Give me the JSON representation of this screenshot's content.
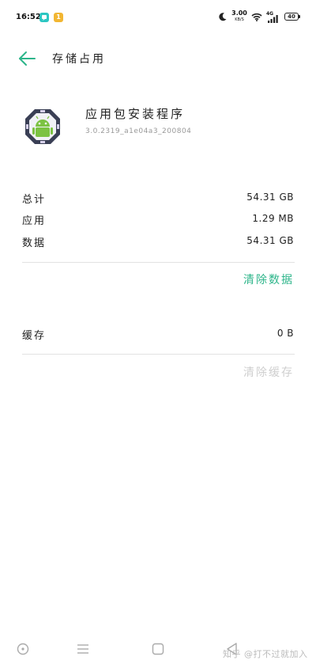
{
  "status_bar": {
    "time": "16:52",
    "notif_2_text": "1",
    "net_speed": "3.00",
    "net_unit": "KB/S",
    "signal_label": "4G",
    "battery": "40"
  },
  "header": {
    "title": "存储占用"
  },
  "app": {
    "name": "应用包安装程序",
    "version": "3.0.2319_a1e04a3_200804"
  },
  "storage": {
    "total_label": "总计",
    "total_value": "54.31 GB",
    "app_label": "应用",
    "app_value": "1.29 MB",
    "data_label": "数据",
    "data_value": "54.31 GB",
    "clear_data_label": "清除数据"
  },
  "cache": {
    "label": "缓存",
    "value": "0 B",
    "clear_cache_label": "清除缓存"
  },
  "watermark": "知乎 @打不过就加入",
  "colors": {
    "accent": "#2db58a",
    "disabled": "#cfcfcf"
  }
}
